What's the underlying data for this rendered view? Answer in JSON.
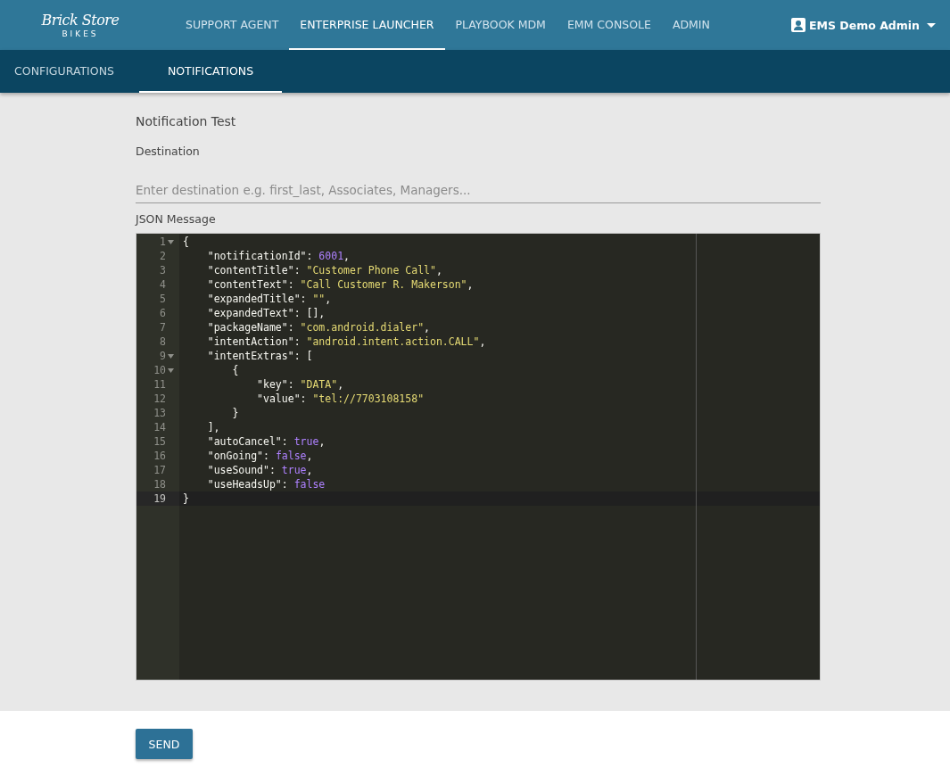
{
  "logo": {
    "name": "Brick Store",
    "sub": "BIKES"
  },
  "nav": [
    {
      "label": "SUPPORT AGENT",
      "selected": false
    },
    {
      "label": "ENTERPRISE LAUNCHER",
      "selected": true
    },
    {
      "label": "PLAYBOOK MDM",
      "selected": false
    },
    {
      "label": "EMM CONSOLE",
      "selected": false
    },
    {
      "label": "ADMIN",
      "selected": false
    }
  ],
  "user": {
    "name": "EMS Demo Admin"
  },
  "subtabs": [
    {
      "label": "CONFIGURATIONS",
      "selected": false
    },
    {
      "label": "NOTIFICATIONS",
      "selected": true
    }
  ],
  "form": {
    "title": "Notification Test",
    "destination_label": "Destination",
    "destination": {
      "placeholder": "Enter destination e.g. first_last, Associates, Managers..."
    },
    "json_label": "JSON Message"
  },
  "editor": {
    "lines": [
      {
        "number": "1",
        "text": "{",
        "foldable": true,
        "active": false
      },
      {
        "number": "2",
        "text": "    \"notificationId\": 6001,",
        "foldable": false,
        "active": false
      },
      {
        "number": "3",
        "text": "    \"contentTitle\": \"Customer Phone Call\",",
        "foldable": false,
        "active": false
      },
      {
        "number": "4",
        "text": "    \"contentText\": \"Call Customer R. Makerson\",",
        "foldable": false,
        "active": false
      },
      {
        "number": "5",
        "text": "    \"expandedTitle\": \"\",",
        "foldable": false,
        "active": false
      },
      {
        "number": "6",
        "text": "    \"expandedText\": [],",
        "foldable": false,
        "active": false
      },
      {
        "number": "7",
        "text": "    \"packageName\": \"com.android.dialer\",",
        "foldable": false,
        "active": false
      },
      {
        "number": "8",
        "text": "    \"intentAction\": \"android.intent.action.CALL\",",
        "foldable": false,
        "active": false
      },
      {
        "number": "9",
        "text": "    \"intentExtras\": [",
        "foldable": true,
        "active": false
      },
      {
        "number": "10",
        "text": "        {",
        "foldable": true,
        "active": false
      },
      {
        "number": "11",
        "text": "            \"key\": \"DATA\",",
        "foldable": false,
        "active": false
      },
      {
        "number": "12",
        "text": "            \"value\": \"tel://7703108158\"",
        "foldable": false,
        "active": false
      },
      {
        "number": "13",
        "text": "        }",
        "foldable": false,
        "active": false
      },
      {
        "number": "14",
        "text": "    ],",
        "foldable": false,
        "active": false
      },
      {
        "number": "15",
        "text": "    \"autoCancel\": true,",
        "foldable": false,
        "active": false
      },
      {
        "number": "16",
        "text": "    \"onGoing\": false,",
        "foldable": false,
        "active": false
      },
      {
        "number": "17",
        "text": "    \"useSound\": true,",
        "foldable": false,
        "active": false
      },
      {
        "number": "18",
        "text": "    \"useHeadsUp\": false",
        "foldable": false,
        "active": false
      },
      {
        "number": "19",
        "text": "}",
        "foldable": false,
        "active": true
      }
    ]
  },
  "send_button": "SEND"
}
